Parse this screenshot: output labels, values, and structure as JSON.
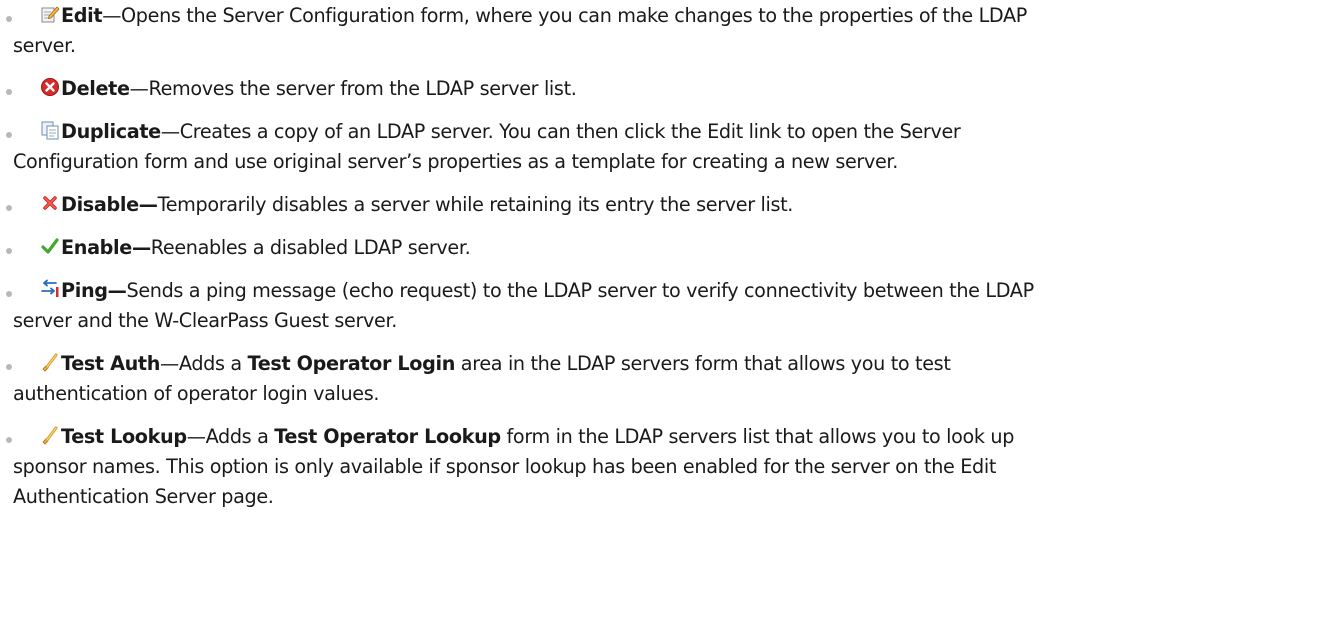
{
  "items": [
    {
      "icon": "edit-icon",
      "term": "Edit",
      "sep": "—",
      "text": "Opens the Server Configuration form, where you can make changes to the properties of the LDAP",
      "cont": "server."
    },
    {
      "icon": "delete-icon",
      "term": "Delete",
      "sep": "—",
      "text": "Removes the server from the LDAP server list."
    },
    {
      "icon": "duplicate-icon",
      "term": "Duplicate",
      "sep": "—",
      "text": "Creates a copy of an LDAP server. You can then click the Edit link to open the Server",
      "cont": "Configuration form and use original server’s properties as a template for creating a new server."
    },
    {
      "icon": "disable-icon",
      "term": "Disable—",
      "text": "Temporarily disables a server while retaining its entry the server list."
    },
    {
      "icon": "enable-icon",
      "term": "Enable—",
      "text": "Reenables a disabled LDAP server."
    },
    {
      "icon": "ping-icon",
      "term": "Ping—",
      "text": "Sends a ping message (echo request) to the LDAP server to verify connectivity between the LDAP",
      "cont": "server and the W-ClearPass Guest server."
    },
    {
      "icon": "test-auth-icon",
      "term": "Test Auth",
      "sep": "—",
      "text_a": "Adds a ",
      "strong": "Test Operator Login",
      "text_b": " area in the LDAP servers form that allows you to test",
      "cont": "authentication of operator login values."
    },
    {
      "icon": "test-lookup-icon",
      "term": "Test Lookup",
      "sep": "—",
      "text_a": "Adds a ",
      "strong": "Test Operator Lookup",
      "text_b": " form in the LDAP servers list that allows you to look up",
      "cont": "sponsor names. This option is only available if sponsor lookup has been enabled for the server on the Edit",
      "cont2": "Authentication Server page."
    }
  ],
  "colors": {
    "bullet": "#b8b8b8",
    "text": "#1a1a1a",
    "delete_red": "#d52b2b",
    "enable_green": "#43a82b",
    "ping_blue": "#2a6fbe"
  }
}
